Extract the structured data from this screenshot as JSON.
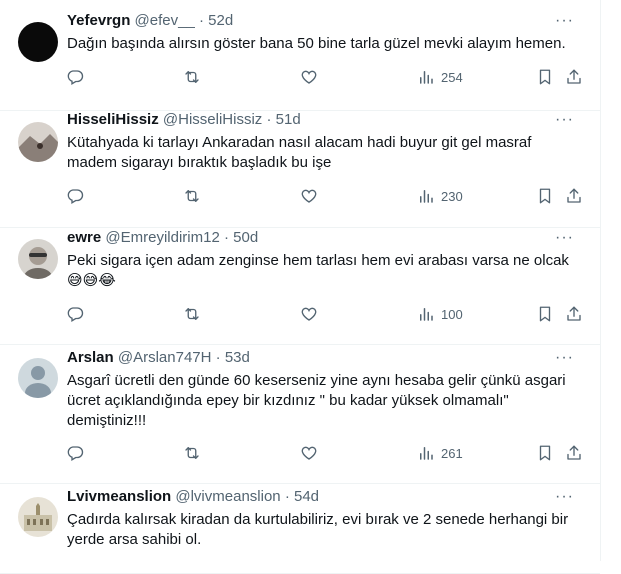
{
  "tweets": [
    {
      "name": "Yefevrgn",
      "handle": "@efev__",
      "sep": "·",
      "age": "52d",
      "lines": [
        "Dağın başında alırsın göster bana 50 bine tarla güzel mevki alayım hemen."
      ],
      "emoji": "",
      "views": "254",
      "avatar_color": "#0a0a0a"
    },
    {
      "name": "HisseliHissiz",
      "handle": "@HisseliHissiz",
      "sep": "·",
      "age": "51d",
      "lines": [
        "Kütahyada ki tarlayı Ankaradan nasıl alacam hadi buyur git gel masraf",
        "madem sigarayı bıraktık başladık bu işe"
      ],
      "emoji": "",
      "views": "230",
      "avatar_color": "#8a7f78"
    },
    {
      "name": "ewre",
      "handle": "@Emreyildirim12",
      "sep": "·",
      "age": "50d",
      "lines": [
        "Peki sigara içen adam zenginse hem tarlası hem evi arabası varsa ne olcak"
      ],
      "emoji": "😅😅😂",
      "views": "100",
      "avatar_color": "#b9b4ae"
    },
    {
      "name": "Arslan",
      "handle": "@Arslan747H",
      "sep": "·",
      "age": "53d",
      "lines": [
        "Asgarî ücretli den günde 60 keserseniz yine aynı hesaba gelir çünkü asgari",
        "ücret açıklandığında epey bir kızdınız \" bu kadar yüksek olmamalı\"",
        "demiştiniz!!!"
      ],
      "emoji": "",
      "views": "261",
      "avatar_color": "#cfd9de"
    },
    {
      "name": "Lvivmeanslion",
      "handle": "@lvivmeanslion",
      "sep": "·",
      "age": "54d",
      "lines": [
        "Çadırda kalırsak kiradan da kurtulabiliriz, evi bırak ve 2 senede herhangi bir",
        "yerde arsa sahibi ol."
      ],
      "emoji": "",
      "views": "",
      "avatar_color": "#c9c1a8"
    }
  ],
  "more_glyph": "···",
  "colors": {
    "text": "#0f1419",
    "muted": "#536471",
    "divider": "#eff3f4"
  }
}
